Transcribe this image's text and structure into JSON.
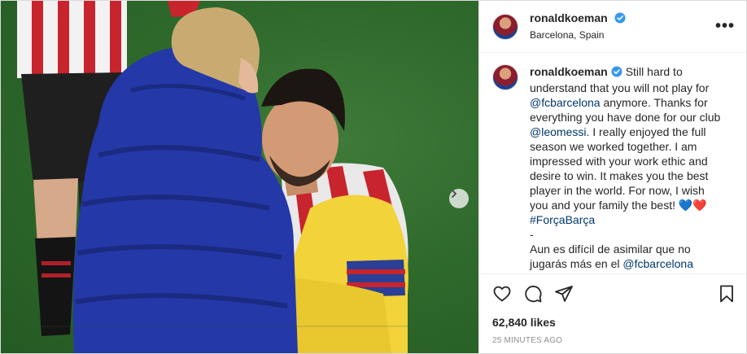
{
  "post": {
    "username": "ronaldkoeman",
    "location": "Barcelona, Spain",
    "caption": {
      "t1": "Still hard to understand that you will not play for ",
      "mention1": "@fcbarcelona",
      "t2": " anymore. Thanks for everything you have done for our club ",
      "mention2": "@leomessi",
      "t3": ". I really enjoyed the full season we worked together. I am impressed with your work ethic and desire to win. It makes you the best player in the world. For now, I wish you and your family the best! ",
      "emoji1": "💙",
      "emoji2": "❤️",
      "hashtag": "#ForçaBarça",
      "dash": "-",
      "t4": "Aun es difícil de asimilar que no jugarás más en el ",
      "mention3": "@fcbarcelona"
    },
    "likes": "62,840 likes",
    "timestamp": "25 MINUTES AGO",
    "colors": {
      "verified": "#3897f0",
      "link": "#00376b",
      "muted": "#8e8e8e"
    },
    "icons": [
      "verified-badge-icon",
      "more-options-icon",
      "like-heart-icon",
      "comment-icon",
      "share-icon",
      "save-bookmark-icon",
      "next-arrow-icon"
    ]
  }
}
